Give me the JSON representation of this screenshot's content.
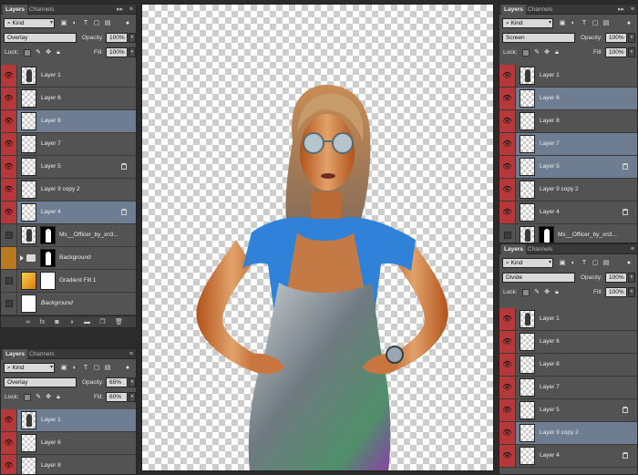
{
  "ui": {
    "tab_layers": "Layers",
    "tab_channels": "Channels",
    "kind": "Kind",
    "opacity_label": "Opacity:",
    "fill_label": "Fill:",
    "lock_label": "Lock:",
    "collapse_glyph": "▸▸",
    "menu_glyph": "≡"
  },
  "panels": {
    "left_top": {
      "blend": "Overlay",
      "opacity": "100%",
      "fill": "100%",
      "layers": [
        {
          "name": "Layer 1"
        },
        {
          "name": "Layer 6"
        },
        {
          "name": "Layer 8"
        },
        {
          "name": "Layer 7"
        },
        {
          "name": "Layer 5"
        },
        {
          "name": "Layer 9 copy 2"
        },
        {
          "name": "Layer 4"
        },
        {
          "name": "Ms__Officer_by_xn3..."
        },
        {
          "name": "Background"
        },
        {
          "name": "Gradient Fill 1"
        },
        {
          "name": "Background"
        }
      ]
    },
    "left_bottom": {
      "blend": "Overlay",
      "opacity": "65%",
      "fill": "60%",
      "layers": [
        {
          "name": "Layer 1"
        },
        {
          "name": "Layer 6"
        },
        {
          "name": "Layer 8"
        }
      ]
    },
    "right_top": {
      "blend": "Screen",
      "opacity": "100%",
      "fill": "100%",
      "layers": [
        {
          "name": "Layer 1"
        },
        {
          "name": "Layer 6"
        },
        {
          "name": "Layer 8"
        },
        {
          "name": "Layer 7"
        },
        {
          "name": "Layer 5"
        },
        {
          "name": "Layer 9 copy 2"
        },
        {
          "name": "Layer 4"
        },
        {
          "name": "Ms__Officer_by_xn3..."
        }
      ]
    },
    "right_bottom": {
      "blend": "Divide",
      "opacity": "100%",
      "fill": "100%",
      "layers": [
        {
          "name": "Layer 1"
        },
        {
          "name": "Layer 6"
        },
        {
          "name": "Layer 8"
        },
        {
          "name": "Layer 7"
        },
        {
          "name": "Layer 5"
        },
        {
          "name": "Layer 9 copy 2"
        },
        {
          "name": "Layer 4"
        }
      ]
    }
  }
}
